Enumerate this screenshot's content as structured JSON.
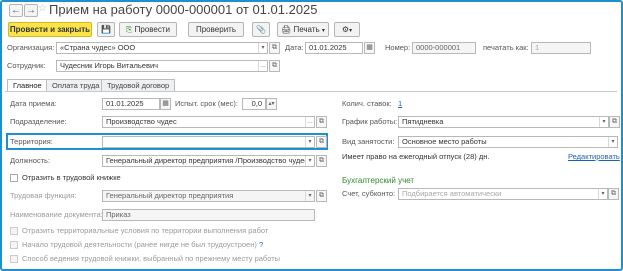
{
  "window": {
    "title": "Прием на работу 0000-000001 от 01.01.2025",
    "back_icon": "←",
    "forward_icon": "→",
    "star_icon": "☆"
  },
  "toolbar": {
    "post_and_close": "Провести и закрыть",
    "post": "Провести",
    "check": "Проверить",
    "print": "Печать",
    "save_icon": "💾",
    "post_icon": "⎘",
    "attach_icon": "📎",
    "print_icon": "🖨",
    "more_icon": "⚙"
  },
  "header": {
    "org_label": "Организация:",
    "org_value": "«Страна чудес» ООО",
    "date_label": "Дата:",
    "date_value": "01.01.2025",
    "number_label": "Номер:",
    "number_value": "0000-000001",
    "print_as_label": "печатать как:",
    "print_as_value": "1",
    "employee_label": "Сотрудник:",
    "employee_value": "Чудесник Игорь Витальевич"
  },
  "tabs": [
    {
      "label": "Главное",
      "active": true
    },
    {
      "label": "Оплата труда",
      "active": false
    },
    {
      "label": "Трудовой договор",
      "active": false
    }
  ],
  "main": {
    "hire_date_label": "Дата приема:",
    "hire_date_value": "01.01.2025",
    "probation_label": "Испыт. срок (мес):",
    "probation_value": "0,0",
    "department_label": "Подразделение:",
    "department_value": "Производство чудес",
    "territory_label": "Территория:",
    "territory_value": "",
    "position_label": "Должность:",
    "position_value": "Генеральный директор предприятия /Производство чудес/",
    "show_in_workbook_label": "Отразить в трудовой книжке",
    "labor_function_label": "Трудовая функция:",
    "labor_function_value": "Генеральный директор предприятия",
    "doc_name_label": "Наименование документа:",
    "doc_name_value": "Приказ",
    "territorial_conditions_label": "Отразить в трудовой книжке",
    "territorial_conditions_full": "Отразить территориальные условия по территории выполнения работ",
    "career_start_label": "Начало трудовой деятельности (ранее нигде не был трудоустроен)",
    "workbook_method_label": "Способ ведения трудовой книжки, выбранный по прежнему месту работы",
    "question_mark": "?"
  },
  "right": {
    "rates_label": "Колич. ставок:",
    "rates_value": "1",
    "schedule_label": "График работы:",
    "schedule_value": "Пятидневка",
    "employment_type_label": "Вид занятости:",
    "employment_type_value": "Основное место работы",
    "vacation_text": "Имеет право на ежегодный отпуск (28) дн.",
    "edit_link": "Редактировать",
    "accounting_section": "Бухгалтерский учет",
    "account_label": "Счет, субконто:",
    "account_placeholder": "Подбирается автоматически"
  },
  "colors": {
    "accent": "#1f8fcf",
    "primary_button": "#fbe34a",
    "link": "#1a63b8",
    "section": "#2e8b2e"
  }
}
